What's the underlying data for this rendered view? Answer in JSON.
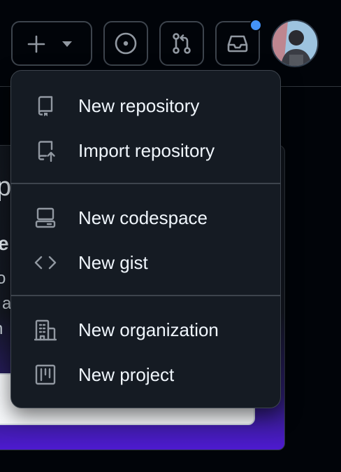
{
  "header": {
    "create_button": {
      "icon": "plus-icon",
      "dropdown_icon": "triangle-down-icon"
    },
    "issues_button": {
      "icon": "issue-opened-icon"
    },
    "pulls_button": {
      "icon": "git-pull-request-icon"
    },
    "inbox_button": {
      "icon": "inbox-icon",
      "has_unread": true
    },
    "avatar": {
      "icon": "user-avatar"
    }
  },
  "create_menu": {
    "groups": [
      {
        "items": [
          {
            "icon": "repo-icon",
            "label": "New repository"
          },
          {
            "icon": "repo-push-icon",
            "label": "Import repository"
          }
        ]
      },
      {
        "items": [
          {
            "icon": "codespaces-icon",
            "label": "New codespace"
          },
          {
            "icon": "code-icon",
            "label": "New gist"
          }
        ]
      },
      {
        "items": [
          {
            "icon": "organization-icon",
            "label": "New organization"
          },
          {
            "icon": "project-icon",
            "label": "New project"
          }
        ]
      }
    ]
  },
  "colors": {
    "background": "#010409",
    "menu_background": "#151b23",
    "border": "#3d444d",
    "text": "#f0f6fc",
    "icon": "#9198a1",
    "notification": "#4493f8"
  }
}
